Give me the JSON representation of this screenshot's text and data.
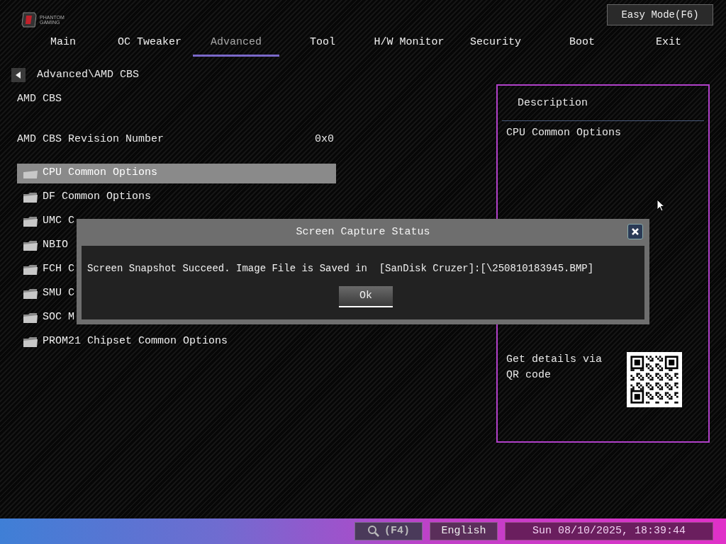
{
  "logo": {
    "line1": "PHANTOM",
    "line2": "GAMING"
  },
  "easy_mode_button": "Easy Mode(F6)",
  "tabs": [
    {
      "label": "Main",
      "selected": false
    },
    {
      "label": "OC Tweaker",
      "selected": false
    },
    {
      "label": "Advanced",
      "selected": true
    },
    {
      "label": "Tool",
      "selected": false
    },
    {
      "label": "H/W Monitor",
      "selected": false
    },
    {
      "label": "Security",
      "selected": false
    },
    {
      "label": "Boot",
      "selected": false
    },
    {
      "label": "Exit",
      "selected": false
    }
  ],
  "breadcrumb": "Advanced\\AMD CBS",
  "section_title": "AMD CBS",
  "revision": {
    "label": "AMD CBS Revision Number",
    "value": "0x0"
  },
  "menu_items": [
    {
      "label": "CPU Common Options",
      "selected": true
    },
    {
      "label": "DF Common Options",
      "selected": false
    },
    {
      "label": "UMC C",
      "selected": false
    },
    {
      "label": "NBIO",
      "selected": false
    },
    {
      "label": "FCH C",
      "selected": false
    },
    {
      "label": "SMU C",
      "selected": false
    },
    {
      "label": "SOC M",
      "selected": false
    },
    {
      "label": "PROM21 Chipset Common Options",
      "selected": false
    }
  ],
  "description": {
    "title": "Description",
    "text": "CPU Common Options",
    "qr_text": "Get details via QR code"
  },
  "dialog": {
    "title": "Screen Capture Status",
    "message": "Screen Snapshot Succeed. Image File is Saved in  [SanDisk Cruzer]:[\\250810183945.BMP]",
    "button": "Ok"
  },
  "bottom_bar": {
    "search_key": "(F4)",
    "language": "English",
    "datetime": "Sun 08/10/2025, 18:39:44"
  }
}
